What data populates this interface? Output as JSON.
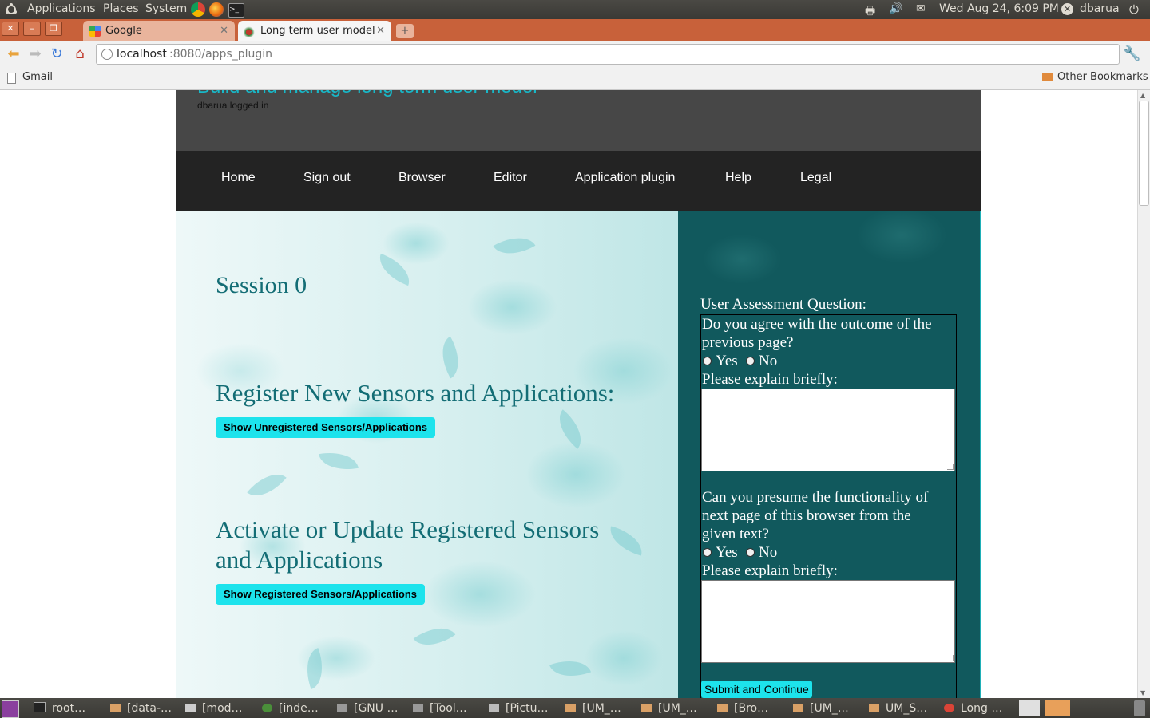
{
  "panel": {
    "menus": [
      "Applications",
      "Places",
      "System"
    ],
    "datetime": "Wed Aug 24,  6:09 PM",
    "user": "dbarua"
  },
  "browser": {
    "tabs": [
      {
        "title": "Google"
      },
      {
        "title": "Long term user model"
      }
    ],
    "url_host": "localhost",
    "url_path": ":8080/apps_plugin",
    "bookmarks": {
      "left": "Gmail",
      "right": "Other Bookmarks"
    }
  },
  "site": {
    "title": "Build and manage long term user model",
    "login_status": "dbarua logged in",
    "nav": [
      "Home",
      "Sign out",
      "Browser",
      "Editor",
      "Application plugin",
      "Help",
      "Legal"
    ]
  },
  "main": {
    "session": "Session 0",
    "register_heading": "Register New Sensors and Applications:",
    "register_button": "Show Unregistered Sensors/Applications",
    "activate_heading_line1": "Activate or Update Registered Sensors",
    "activate_heading_line2": "and Applications",
    "activate_button": "Show Registered Sensors/Applications"
  },
  "assessment": {
    "title": "User Assessment Question:",
    "q1_line1": "Do you agree with the outcome of the",
    "q1_line2": "previous page?",
    "q2_line1": "Can you presume the functionality of",
    "q2_line2": "next page of this browser from the",
    "q2_line3": "given text?",
    "yes": "Yes",
    "no": "No",
    "explain": "Please explain briefly:",
    "submit": "Submit and Continue"
  },
  "taskbar": {
    "items": [
      "root…",
      "[data-…",
      "[mod…",
      "[inde…",
      "[GNU …",
      "[Tool…",
      "[Pictu…",
      "[UM_…",
      "[UM_…",
      "[Bro…",
      "[UM_…",
      "UM_S…",
      "Long …"
    ]
  },
  "colors": {
    "accent_cyan": "#1de3ec",
    "teal_panel": "#11595d",
    "heading_teal": "#136d75",
    "chrome_orange": "#c8613a"
  }
}
